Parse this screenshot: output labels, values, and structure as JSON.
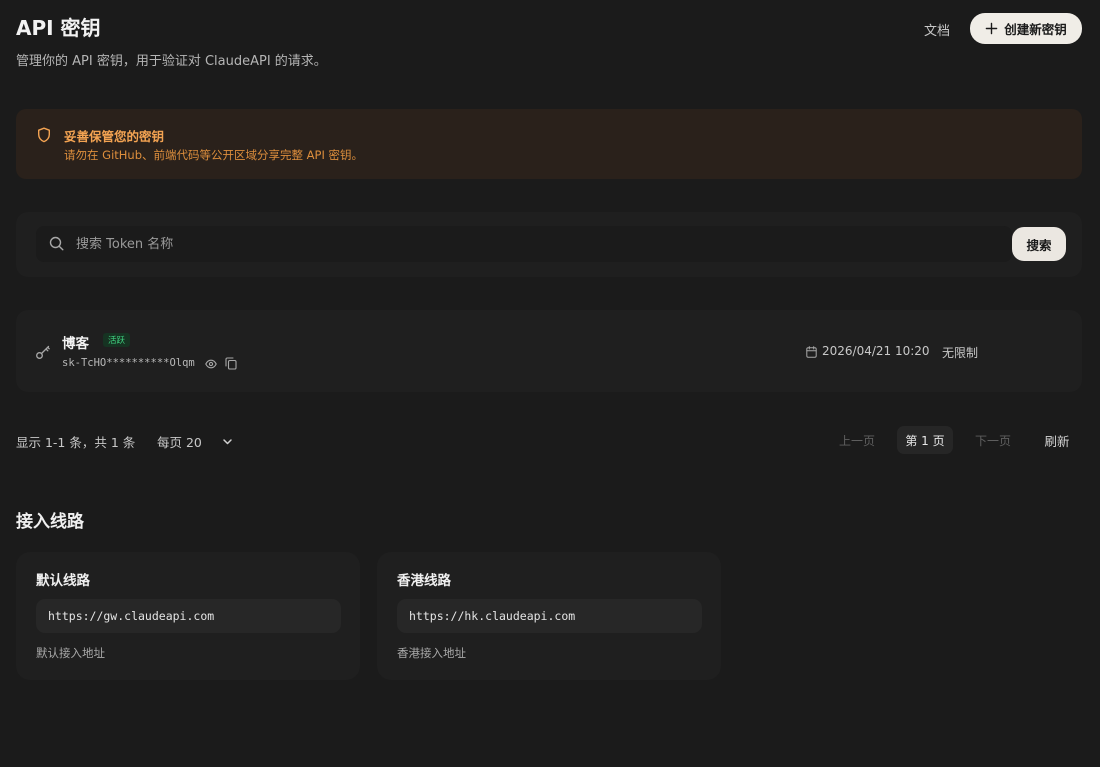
{
  "header": {
    "title": "API 密钥",
    "subtitle": "管理你的 API 密钥，用于验证对 ClaudeAPI 的请求。",
    "docs_label": "文档",
    "create_label": "创建新密钥"
  },
  "warning": {
    "title": "妥善保管您的密钥",
    "text": "请勿在 GitHub、前端代码等公开区域分享完整 API 密钥。",
    "color": "#f3a352"
  },
  "search": {
    "placeholder": "搜索 Token 名称",
    "value": "",
    "button_label": "搜索"
  },
  "tokens": [
    {
      "name": "博客",
      "status": "活跃",
      "key": "sk-TcHO**********Olqm",
      "date": "2026/04/21 10:20",
      "quota": "无限制",
      "status_color": "#3fcf7f"
    }
  ],
  "pagination": {
    "info": "显示 1-1 条，共 1 条",
    "page_size": "每页 20",
    "prev": "上一页",
    "current": "第 1 页",
    "next": "下一页",
    "refresh": "刷新"
  },
  "routes": {
    "title": "接入线路",
    "items": [
      {
        "name": "默认线路",
        "url": "https://gw.claudeapi.com",
        "desc": "默认接入地址"
      },
      {
        "name": "香港线路",
        "url": "https://hk.claudeapi.com",
        "desc": "香港接入地址"
      }
    ]
  },
  "icons": [
    "plus-icon",
    "shield-icon",
    "search-icon",
    "key-icon",
    "eye-icon",
    "copy-icon",
    "calendar-icon",
    "chevron-down-icon"
  ]
}
